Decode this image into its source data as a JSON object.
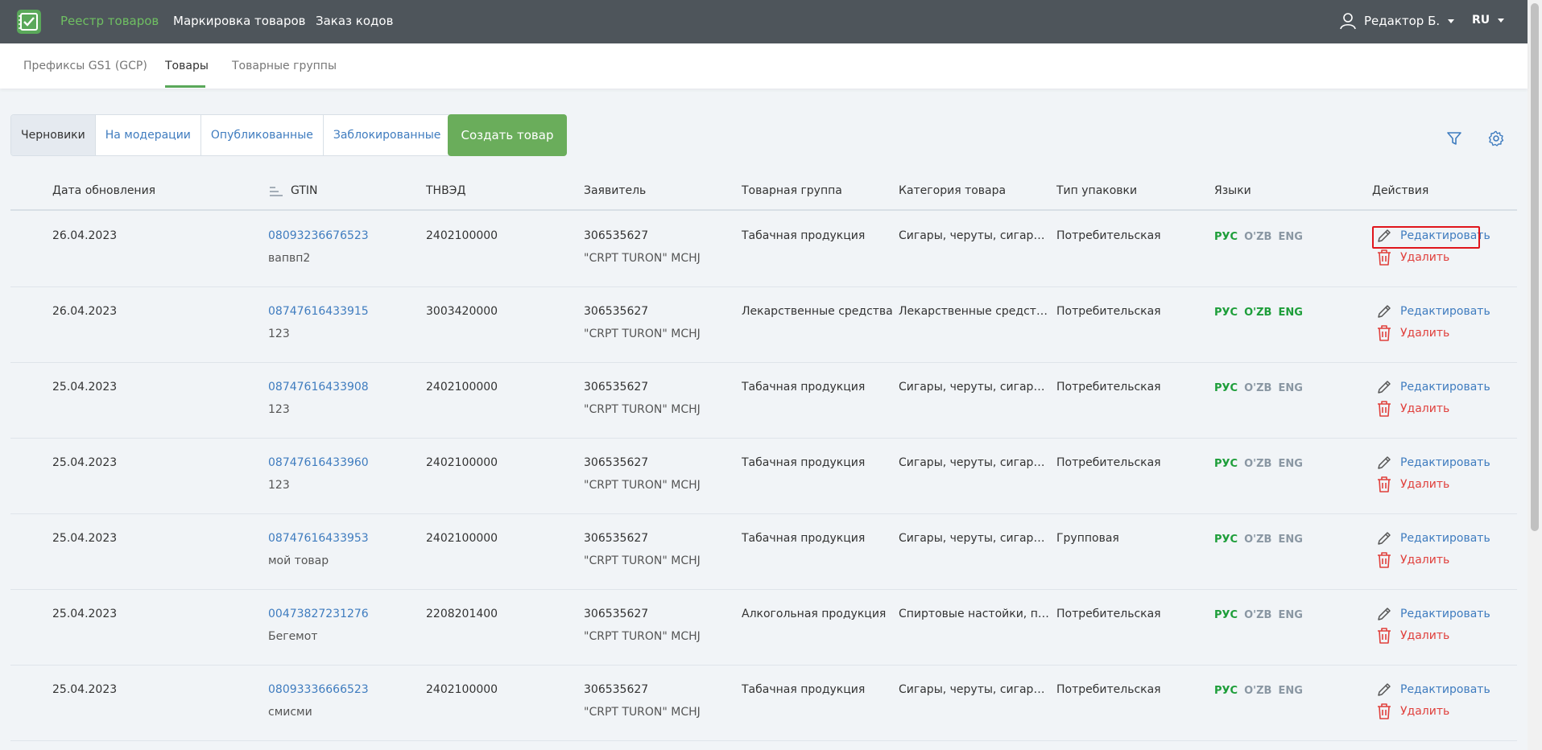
{
  "topnav": {
    "items": [
      "Реестр товаров",
      "Маркировка товаров",
      "Заказ кодов"
    ],
    "user": "Редактор Б.",
    "lang": "RU"
  },
  "subnav": {
    "tabs": [
      "Префиксы GS1 (GCP)",
      "Товары",
      "Товарные группы"
    ]
  },
  "status_tabs": [
    "Черновики",
    "На модерации",
    "Опубликованные",
    "Заблокированные"
  ],
  "create_button": "Создать товар",
  "columns": [
    "Дата обновления",
    "GTIN",
    "ТНВЭД",
    "Заявитель",
    "Товарная группа",
    "Категория товара",
    "Тип упаковки",
    "Языки",
    "Действия"
  ],
  "actions": {
    "edit": "Редактировать",
    "delete": "Удалить"
  },
  "language_labels": [
    "РУС",
    "O'ZB",
    "ENG"
  ],
  "rows": [
    {
      "date": "26.04.2023",
      "gtin": "08093236676523",
      "name": "вапвп2",
      "tnved": "2402100000",
      "applicant_id": "306535627",
      "applicant_name": "\"CRPT TURON\" MCHJ",
      "group": "Табачная продукция",
      "category": "Сигары, черуты, сигари...",
      "pack": "Потребительская",
      "langs_active": [
        true,
        false,
        false
      ]
    },
    {
      "date": "26.04.2023",
      "gtin": "08747616433915",
      "name": "123",
      "tnved": "3003420000",
      "applicant_id": "306535627",
      "applicant_name": "\"CRPT TURON\" MCHJ",
      "group": "Лекарственные средства",
      "category": "Лекарственные средств...",
      "pack": "Потребительская",
      "langs_active": [
        true,
        true,
        true
      ]
    },
    {
      "date": "25.04.2023",
      "gtin": "08747616433908",
      "name": "123",
      "tnved": "2402100000",
      "applicant_id": "306535627",
      "applicant_name": "\"CRPT TURON\" MCHJ",
      "group": "Табачная продукция",
      "category": "Сигары, черуты, сигари...",
      "pack": "Потребительская",
      "langs_active": [
        true,
        false,
        false
      ]
    },
    {
      "date": "25.04.2023",
      "gtin": "08747616433960",
      "name": "123",
      "tnved": "2402100000",
      "applicant_id": "306535627",
      "applicant_name": "\"CRPT TURON\" MCHJ",
      "group": "Табачная продукция",
      "category": "Сигары, черуты, сигари...",
      "pack": "Потребительская",
      "langs_active": [
        true,
        false,
        false
      ]
    },
    {
      "date": "25.04.2023",
      "gtin": "08747616433953",
      "name": "мой товар",
      "tnved": "2402100000",
      "applicant_id": "306535627",
      "applicant_name": "\"CRPT TURON\" MCHJ",
      "group": "Табачная продукция",
      "category": "Сигары, черуты, сигари...",
      "pack": "Групповая",
      "langs_active": [
        true,
        false,
        false
      ]
    },
    {
      "date": "25.04.2023",
      "gtin": "00473827231276",
      "name": "Бегемот",
      "tnved": "2208201400",
      "applicant_id": "306535627",
      "applicant_name": "\"CRPT TURON\" MCHJ",
      "group": "Алкогольная продукция",
      "category": "Спиртовые настойки, по...",
      "pack": "Потребительская",
      "langs_active": [
        true,
        false,
        false
      ]
    },
    {
      "date": "25.04.2023",
      "gtin": "08093336666523",
      "name": "смисми",
      "tnved": "2402100000",
      "applicant_id": "306535627",
      "applicant_name": "\"CRPT TURON\" MCHJ",
      "group": "Табачная продукция",
      "category": "Сигары, черуты, сигари...",
      "pack": "Потребительская",
      "langs_active": [
        true,
        false,
        false
      ]
    }
  ]
}
